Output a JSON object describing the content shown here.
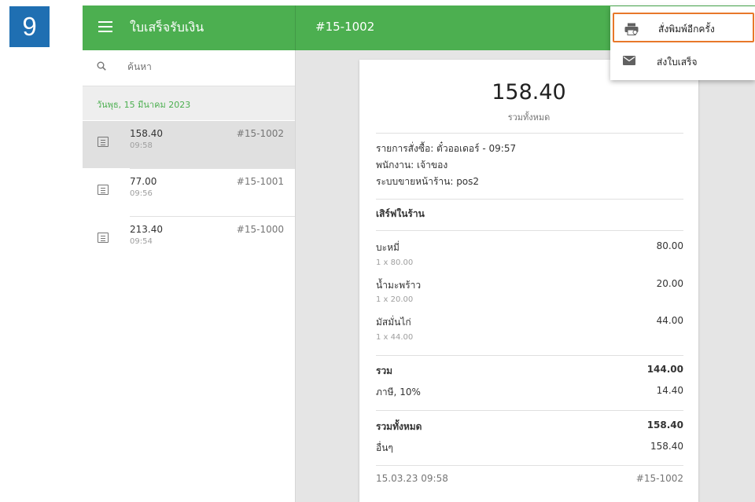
{
  "step_number": "9",
  "header": {
    "title": "ใบเสร็จรับเงิน",
    "receipt_id": "#15-1002"
  },
  "search": {
    "placeholder": "ค้นหา"
  },
  "list": {
    "date_header": "วันพุธ, 15 มีนาคม 2023",
    "receipts": [
      {
        "amount": "158.40",
        "time": "09:58",
        "id": "#15-1002",
        "selected": true
      },
      {
        "amount": "77.00",
        "time": "09:56",
        "id": "#15-1001",
        "selected": false
      },
      {
        "amount": "213.40",
        "time": "09:54",
        "id": "#15-1000",
        "selected": false
      }
    ]
  },
  "receipt": {
    "total": "158.40",
    "total_caption": "รวมทั้งหมด",
    "order_line": "รายการสั่งซื้อ: ตั๋วออเดอร์ - 09:57",
    "employee_line": "พนักงาน: เจ้าของ",
    "pos_line": "ระบบขายหน้าร้าน: pos2",
    "dining_option": "เสิร์ฟในร้าน",
    "items": [
      {
        "name": "บะหมี่",
        "detail": "1 x 80.00",
        "price": "80.00"
      },
      {
        "name": "น้ำมะพร้าว",
        "detail": "1 x 20.00",
        "price": "20.00"
      },
      {
        "name": "มัสมั่นไก่",
        "detail": "1 x 44.00",
        "price": "44.00"
      }
    ],
    "subtotal_label": "รวม",
    "subtotal_value": "144.00",
    "tax_label": "ภาษี, 10%",
    "tax_value": "14.40",
    "grand_total_label": "รวมทั้งหมด",
    "grand_total_value": "158.40",
    "payment_label": "อื่นๆ",
    "payment_value": "158.40",
    "footer_datetime": "15.03.23 09:58",
    "footer_id": "#15-1002"
  },
  "menu": {
    "reprint_label": "สั่งพิมพ์อีกครั้ง",
    "send_label": "ส่งใบเสร็จ"
  },
  "colors": {
    "toolbar": "#4caf50",
    "step_badge": "#1f6fb2",
    "highlight_border": "#e8782a"
  }
}
